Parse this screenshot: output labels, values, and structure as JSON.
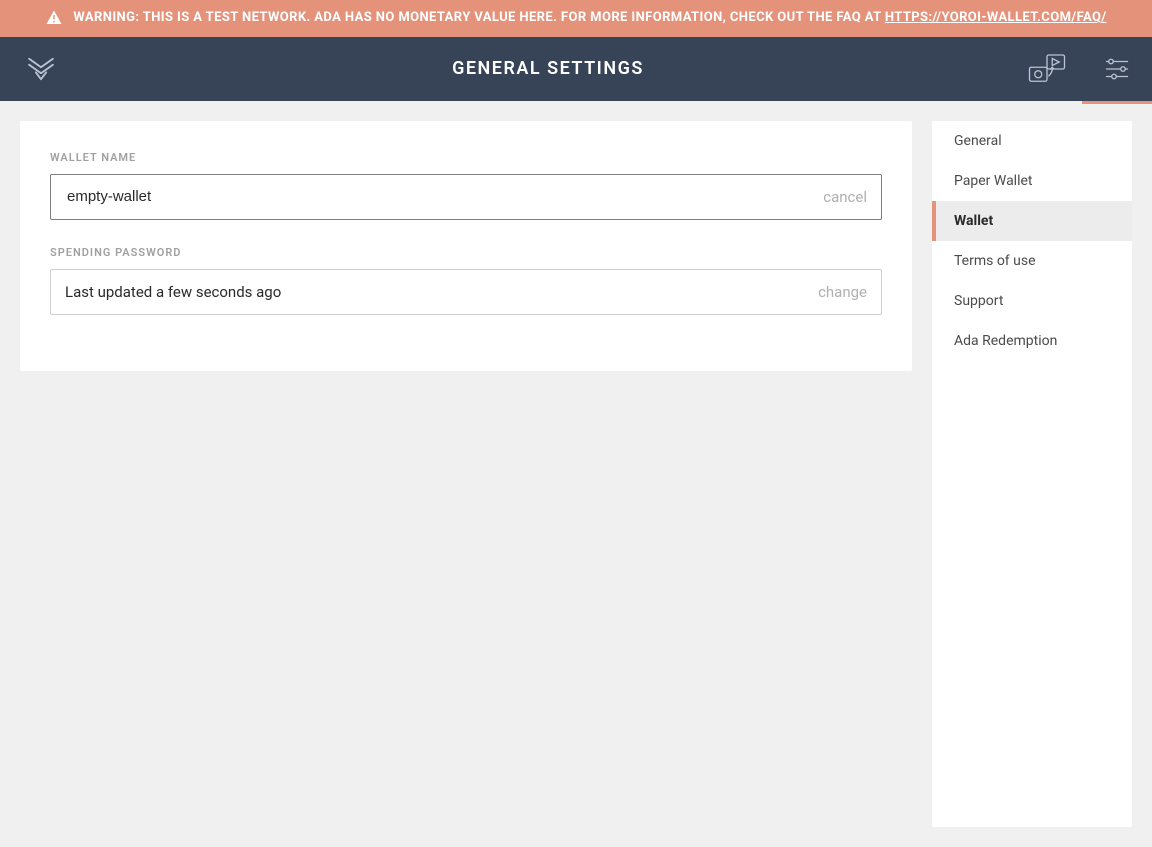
{
  "banner": {
    "prefix": "WARNING: THIS IS A TEST NETWORK. ADA HAS NO MONETARY VALUE HERE. FOR MORE INFORMATION, CHECK OUT THE FAQ AT ",
    "link_text": "HTTPS://YOROI-WALLET.COM/FAQ/"
  },
  "header": {
    "title": "GENERAL SETTINGS"
  },
  "form": {
    "wallet_name": {
      "label": "WALLET NAME",
      "value": "empty-wallet",
      "action": "cancel"
    },
    "spending_password": {
      "label": "SPENDING PASSWORD",
      "status": "Last updated a few seconds ago",
      "action": "change"
    }
  },
  "sidebar": {
    "items": [
      {
        "label": "General",
        "active": false
      },
      {
        "label": "Paper Wallet",
        "active": false
      },
      {
        "label": "Wallet",
        "active": true
      },
      {
        "label": "Terms of use",
        "active": false
      },
      {
        "label": "Support",
        "active": false
      },
      {
        "label": "Ada Redemption",
        "active": false
      }
    ]
  }
}
